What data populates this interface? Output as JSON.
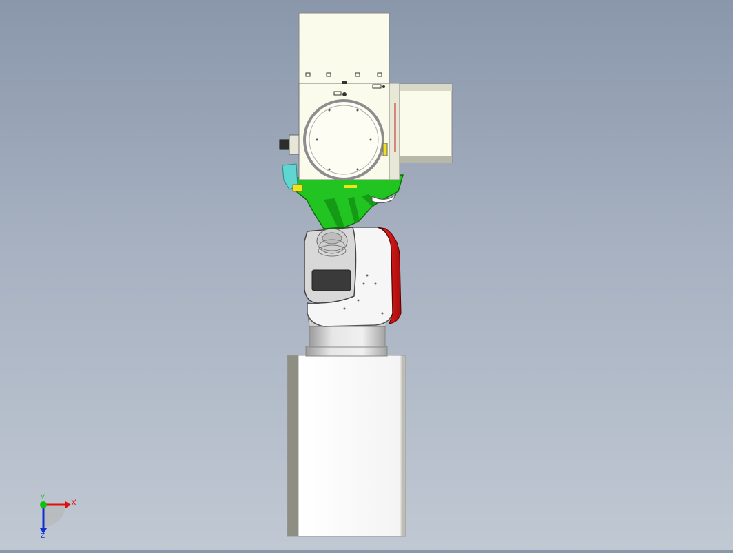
{
  "view": {
    "background_top": "#8a97ab",
    "background_bottom": "#c0c8d3"
  },
  "model": {
    "colors": {
      "body": "#fbfbec",
      "body_side": "#e8e8d6",
      "green": "#22c422",
      "green_dark": "#149a14",
      "red": "#d41414",
      "metal": "#c9c9c9",
      "pedestal": "#f4f4f4",
      "pedestal_shade": "#8e8e82",
      "cyan": "#5fd7d0",
      "yellow": "#f2e21d",
      "window": "#3a3a3a"
    }
  },
  "triad": {
    "x_label": "X",
    "y_label": "Y",
    "z_label": "Z",
    "x_color": "#e01010",
    "y_color": "#10c010",
    "z_color": "#1030d0"
  }
}
